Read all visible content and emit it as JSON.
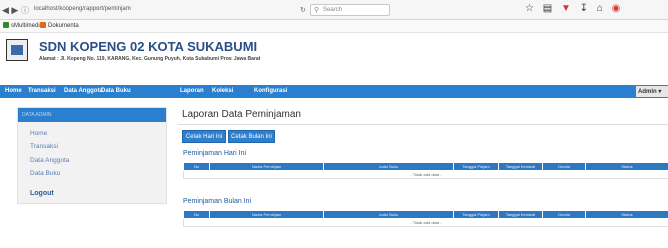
{
  "browser": {
    "url": "localhost/koopeng/rapport/peminjam",
    "search_placeholder": "Search",
    "icons": [
      "star-icon",
      "clipboard-icon",
      "pocket-icon",
      "download-icon",
      "home-icon",
      "firefox-icon"
    ]
  },
  "bookmarks": [
    {
      "label": "sMultimedia",
      "color": "#2d8a2d"
    },
    {
      "label": "Dokumenta",
      "color": "#e06a1a"
    }
  ],
  "school": {
    "name": "SDN KOPENG 02 KOTA SUKABUMI",
    "address": "Alamat : Jl. Kopeng No. 119, KARANG, Kec. Gunung Puyuh, Kota Sukabumi Prov. Jawa Barat"
  },
  "nav": {
    "items": [
      "Home",
      "Transaksi",
      "Data Anggota",
      "Data Buku",
      "Laporan",
      "Koleksi",
      "Konfigurasi"
    ],
    "admin": "Admin"
  },
  "sidebar": {
    "header": "DATA ADMIN",
    "items": [
      "Home",
      "Transaksi",
      "Data Anggota",
      "Data Buku"
    ],
    "logout": "Logout"
  },
  "main": {
    "title": "Laporan Data Peminjaman",
    "buttons": {
      "today": "Cetak Hari Ini",
      "month": "Cetak Bulan Ini"
    },
    "section_today": "Peminjaman Hari Ini",
    "section_month": "Peminjaman Bulan Ini",
    "columns": [
      "No",
      "Nama Peminjam",
      "Judul Buku",
      "Tanggal Pinjam",
      "Tanggal Kembali",
      "Denda",
      "Status"
    ],
    "empty_text": "- Tidak ada data -"
  },
  "colors": {
    "accent": "#2b7fcf",
    "header_text": "#2b4e86",
    "table_header": "#2e78c2"
  }
}
